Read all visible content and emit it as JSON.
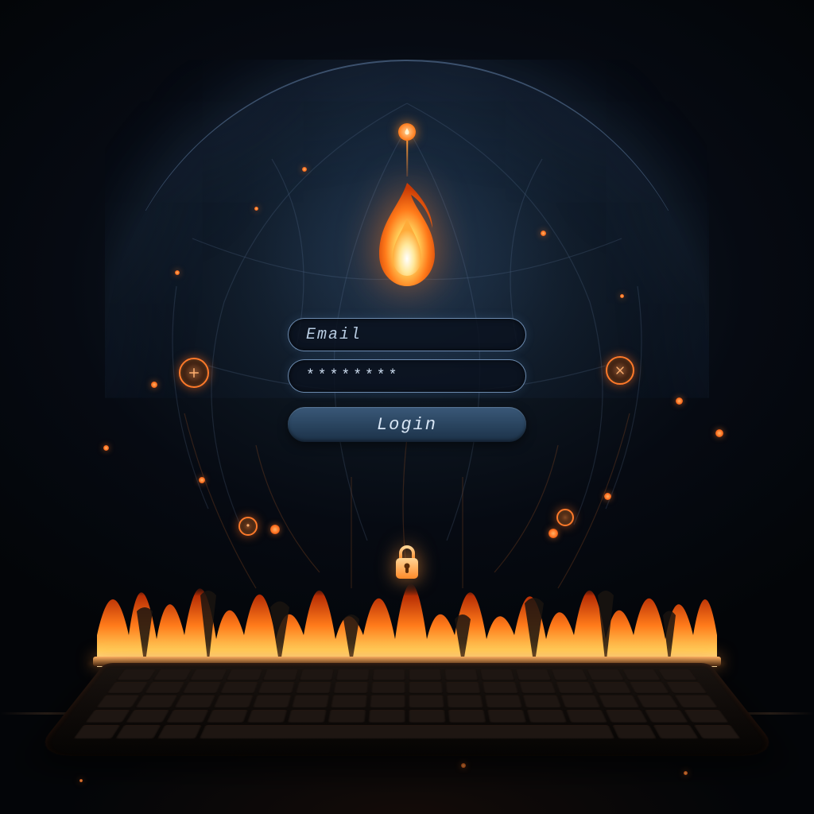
{
  "form": {
    "email_placeholder": "Email",
    "email_value": "",
    "password_value": "********",
    "login_label": "Login"
  },
  "icons": {
    "flame": "flame-icon",
    "lock": "lock-icon",
    "top_badge": "flame-badge-icon",
    "node_left": "plus-node-icon",
    "node_right": "cross-node-icon"
  },
  "colors": {
    "accent_flame": "#ff7a1a",
    "accent_glow": "#8fb8e6",
    "field_border": "#96bee6",
    "button_bg": "#2a4560"
  }
}
